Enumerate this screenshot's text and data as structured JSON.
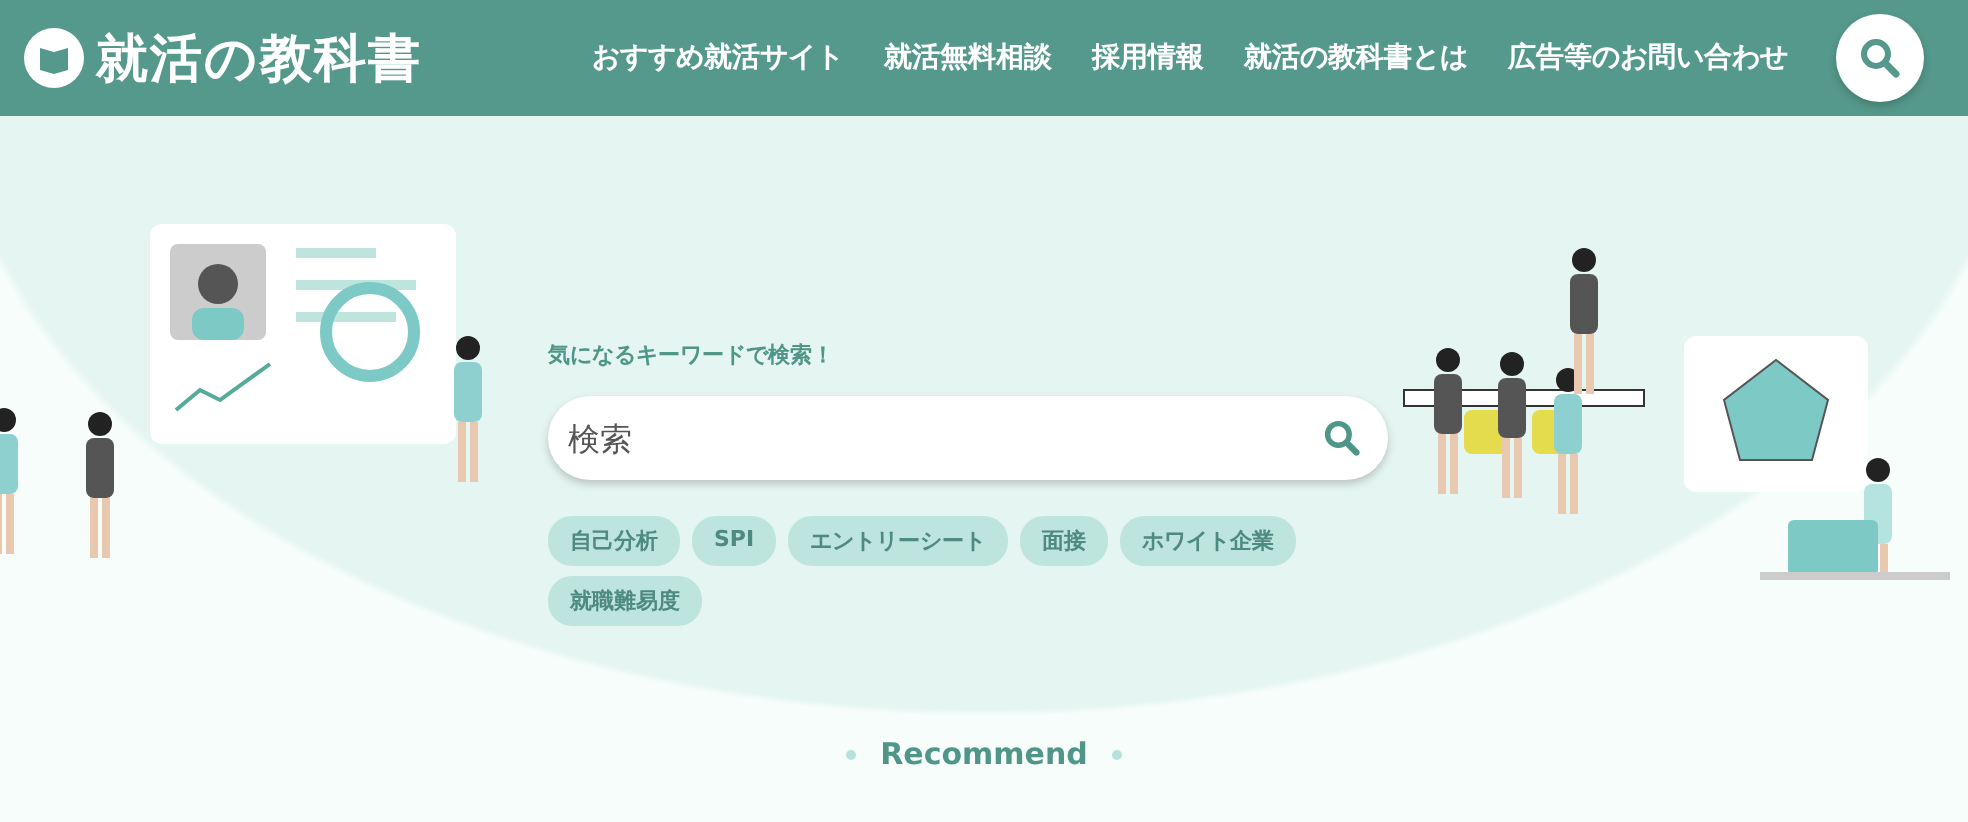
{
  "header": {
    "logo": "就活の教科書",
    "nav": [
      "おすすめ就活サイト",
      "就活無料相談",
      "採用情報",
      "就活の教科書とは",
      "広告等のお問い合わせ"
    ]
  },
  "search": {
    "prompt": "気になるキーワードで検索！",
    "placeholder": "検索",
    "tags": [
      "自己分析",
      "SPI",
      "エントリーシート",
      "面接",
      "ホワイト企業",
      "就職難易度"
    ]
  },
  "recommend": {
    "label": "Recommend"
  }
}
